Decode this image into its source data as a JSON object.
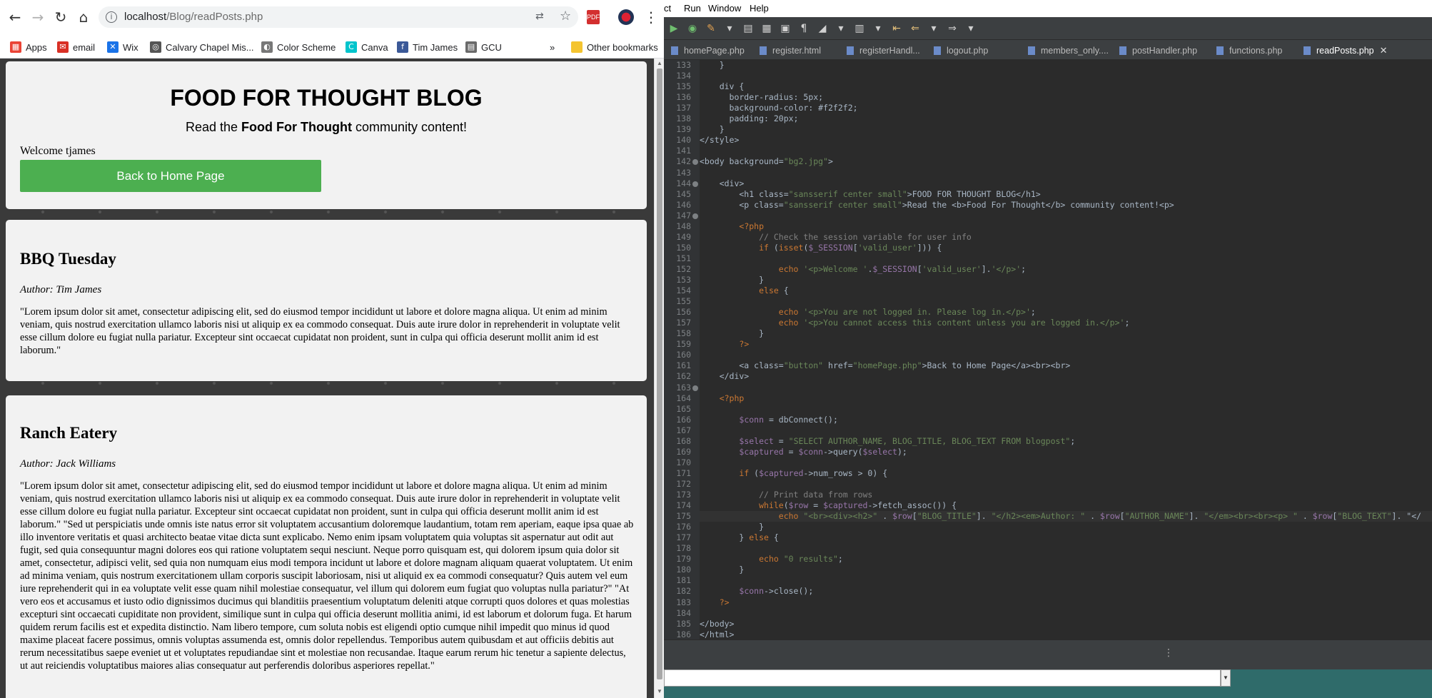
{
  "browser": {
    "url": "localhost/Blog/readPosts.php",
    "url_host": "localhost",
    "url_path": "/Blog/readPosts.php",
    "bookmarks": [
      {
        "label": "Apps",
        "color": "#ea4335"
      },
      {
        "label": "email",
        "color": "#d93025"
      },
      {
        "label": "Wix",
        "color": "#1a73e8"
      },
      {
        "label": "Calvary Chapel Mis...",
        "color": "#555555"
      },
      {
        "label": "Color Scheme",
        "color": "#777777"
      },
      {
        "label": "Canva",
        "color": "#00c4cc"
      },
      {
        "label": "Tim James",
        "color": "#3b5998"
      },
      {
        "label": "GCU",
        "color": "#6a6a6a"
      }
    ],
    "overflow_label": "»",
    "other_bookmarks": "Other bookmarks"
  },
  "page": {
    "title": "FOOD FOR THOUGHT BLOG",
    "subtitle_pre": "Read the ",
    "subtitle_bold": "Food For Thought",
    "subtitle_post": " community content!",
    "welcome": "Welcome tjames",
    "home_button": "Back to Home Page",
    "accent_color": "#4caf50",
    "posts": [
      {
        "title": "BBQ Tuesday",
        "author": "Author: Tim James",
        "text": "\"Lorem ipsum dolor sit amet, consectetur adipiscing elit, sed do eiusmod tempor incididunt ut labore et dolore magna aliqua. Ut enim ad minim veniam, quis nostrud exercitation ullamco laboris nisi ut aliquip ex ea commodo consequat. Duis aute irure dolor in reprehenderit in voluptate velit esse cillum dolore eu fugiat nulla pariatur. Excepteur sint occaecat cupidatat non proident, sunt in culpa qui officia deserunt mollit anim id est laborum.\""
      },
      {
        "title": "Ranch Eatery",
        "author": "Author: Jack Williams",
        "text": "\"Lorem ipsum dolor sit amet, consectetur adipiscing elit, sed do eiusmod tempor incididunt ut labore et dolore magna aliqua. Ut enim ad minim veniam, quis nostrud exercitation ullamco laboris nisi ut aliquip ex ea commodo consequat. Duis aute irure dolor in reprehenderit in voluptate velit esse cillum dolore eu fugiat nulla pariatur. Excepteur sint occaecat cupidatat non proident, sunt in culpa qui officia deserunt mollit anim id est laborum.\" \"Sed ut perspiciatis unde omnis iste natus error sit voluptatem accusantium doloremque laudantium, totam rem aperiam, eaque ipsa quae ab illo inventore veritatis et quasi architecto beatae vitae dicta sunt explicabo. Nemo enim ipsam voluptatem quia voluptas sit aspernatur aut odit aut fugit, sed quia consequuntur magni dolores eos qui ratione voluptatem sequi nesciunt. Neque porro quisquam est, qui dolorem ipsum quia dolor sit amet, consectetur, adipisci velit, sed quia non numquam eius modi tempora incidunt ut labore et dolore magnam aliquam quaerat voluptatem. Ut enim ad minima veniam, quis nostrum exercitationem ullam corporis suscipit laboriosam, nisi ut aliquid ex ea commodi consequatur? Quis autem vel eum iure reprehenderit qui in ea voluptate velit esse quam nihil molestiae consequatur, vel illum qui dolorem eum fugiat quo voluptas nulla pariatur?\" \"At vero eos et accusamus et iusto odio dignissimos ducimus qui blanditiis praesentium voluptatum deleniti atque corrupti quos dolores et quas molestias excepturi sint occaecati cupiditate non provident, similique sunt in culpa qui officia deserunt mollitia animi, id est laborum et dolorum fuga. Et harum quidem rerum facilis est et expedita distinctio. Nam libero tempore, cum soluta nobis est eligendi optio cumque nihil impedit quo minus id quod maxime placeat facere possimus, omnis voluptas assumenda est, omnis dolor repellendus. Temporibus autem quibusdam et aut officiis debitis aut rerum necessitatibus saepe eveniet ut et voluptates repudiandae sint et molestiae non recusandae. Itaque earum rerum hic tenetur a sapiente delectus, ut aut reiciendis voluptatibus maiores alias consequatur aut perferendis doloribus asperiores repellat.\""
      }
    ]
  },
  "ide": {
    "menu": [
      "ct",
      "Run",
      "Window",
      "Help"
    ],
    "tabs": [
      {
        "label": "homePage.php",
        "active": false
      },
      {
        "label": "register.html",
        "active": false
      },
      {
        "label": "registerHandl...",
        "active": false
      },
      {
        "label": "logout.php",
        "active": false
      },
      {
        "label": "members_only....",
        "active": false
      },
      {
        "label": "postHandler.php",
        "active": false
      },
      {
        "label": "functions.php",
        "active": false
      },
      {
        "label": "readPosts.php",
        "active": true
      }
    ],
    "line_numbers": [
      "133",
      "134",
      "135",
      "136",
      "137",
      "138",
      "139",
      "140",
      "141",
      "142",
      "143",
      "144",
      "145",
      "146",
      "147",
      "148",
      "149",
      "150",
      "151",
      "152",
      "153",
      "154",
      "155",
      "156",
      "157",
      "158",
      "159",
      "160",
      "161",
      "162",
      "163",
      "164",
      "165",
      "166",
      "167",
      "168",
      "169",
      "170",
      "171",
      "172",
      "173",
      "174",
      "175",
      "176",
      "177",
      "178",
      "179",
      "180",
      "181",
      "182",
      "183",
      "184",
      "185",
      "186"
    ],
    "code": [
      "    }",
      "",
      "    div {",
      "      border-radius: 5px;",
      "      background-color: #f2f2f2;",
      "      padding: 20px;",
      "    }",
      "</style>",
      "",
      "<body background=\"bg2.jpg\">",
      "",
      "    <div>",
      "        <h1 class=\"sansserif center small\">FOOD FOR THOUGHT BLOG</h1>",
      "        <p class=\"sansserif center small\">Read the <b>Food For Thought</b> community content!<p>",
      "",
      "        <?php",
      "            // Check the session variable for user info",
      "            if (isset($_SESSION['valid_user'])) {",
      "",
      "                echo '<p>Welcome '.$_SESSION['valid_user'].'</p>';",
      "            }",
      "            else {",
      "",
      "                echo '<p>You are not logged in. Please log in.</p>';",
      "                echo '<p>You cannot access this content unless you are logged in.</p>';",
      "            }",
      "        ?>",
      "",
      "        <a class=\"button\" href=\"homePage.php\">Back to Home Page</a><br><br>",
      "    </div>",
      "",
      "    <?php",
      "",
      "        $conn = dbConnect();",
      "",
      "        $select = \"SELECT AUTHOR_NAME, BLOG_TITLE, BLOG_TEXT FROM blogpost\";",
      "        $captured = $conn->query($select);",
      "",
      "        if ($captured->num_rows > 0) {",
      "",
      "            // Print data from rows",
      "            while($row = $captured->fetch_assoc()) {",
      "                echo \"<br><div><h2>\" . $row[\"BLOG_TITLE\"]. \"</h2><em>Author: \" . $row[\"AUTHOR_NAME\"]. \"</em><br><br><p> \" . $row[\"BLOG_TEXT\"]. \"</",
      "            }",
      "        } else {",
      "",
      "            echo \"0 results\";",
      "        }",
      "",
      "        $conn->close();",
      "    ?>",
      "",
      "</body>",
      "</html>"
    ],
    "fold_lines": [
      "142",
      "144",
      "147",
      "163"
    ],
    "highlighted_line": "175"
  }
}
